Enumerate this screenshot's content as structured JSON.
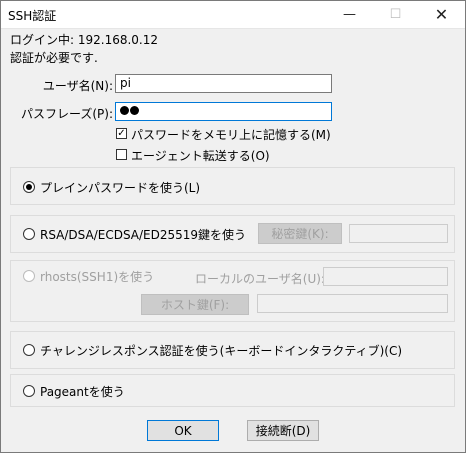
{
  "window": {
    "title": "SSH認証",
    "minimize_glyph": "—",
    "maximize_glyph": "☐",
    "close_glyph": "✕"
  },
  "info": {
    "login_line": "ログイン中: 192.168.0.12",
    "auth_required": "認証が必要です."
  },
  "username": {
    "label": "ユーザ名(N):",
    "value": "pi"
  },
  "passphrase": {
    "label": "パスフレーズ(P):",
    "masked_length": 2
  },
  "options": {
    "remember_password": {
      "label": "パスワードをメモリ上に記憶する(M)",
      "checked": true
    },
    "agent_forwarding": {
      "label": "エージェント転送する(O)",
      "checked": false
    }
  },
  "methods": {
    "plain_password": {
      "label": "プレインパスワードを使う(L)",
      "selected": true
    },
    "key": {
      "label": "RSA/DSA/ECDSA/ED25519鍵を使う",
      "button": "秘密鍵(K):"
    },
    "rhosts": {
      "label": "rhosts(SSH1)を使う",
      "local_user_label": "ローカルのユーザ名(U):",
      "host_key_button": "ホスト鍵(F):"
    },
    "challenge": {
      "label": "チャレンジレスポンス認証を使う(キーボードインタラクティブ)(C)"
    },
    "pageant": {
      "label": "Pageantを使う"
    }
  },
  "buttons": {
    "ok": "OK",
    "disconnect": "接続断(D)"
  }
}
